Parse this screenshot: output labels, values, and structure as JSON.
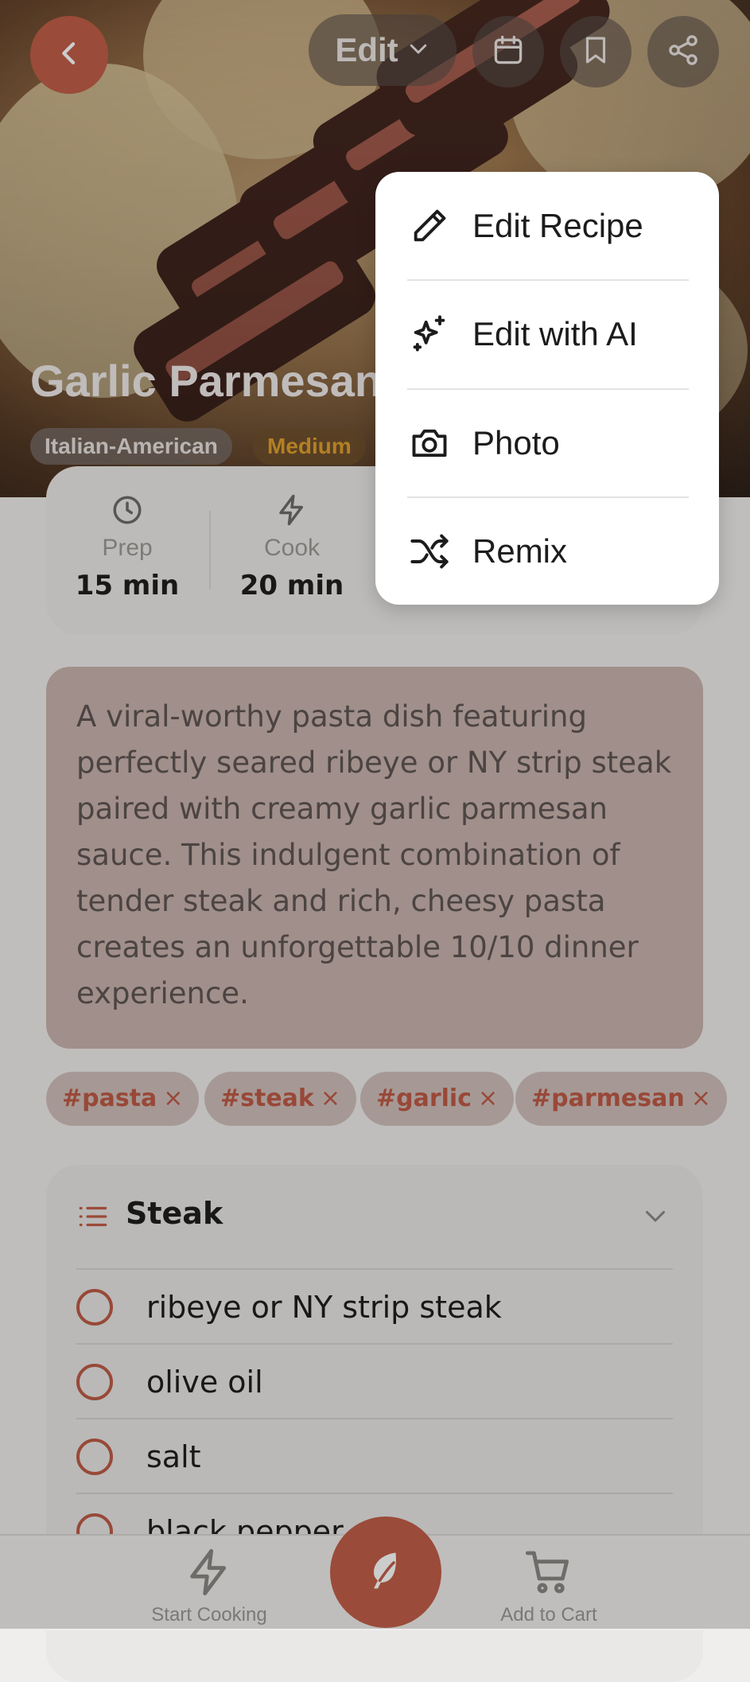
{
  "header": {
    "edit_label": "Edit",
    "icons": [
      "back-arrow-icon",
      "chevron-down-icon",
      "calendar-icon",
      "bookmark-icon",
      "share-icon"
    ]
  },
  "recipe": {
    "title": "Garlic Parmesan",
    "cuisine": "Italian-American",
    "difficulty": "Medium",
    "stats": [
      {
        "label": "Prep",
        "value": "15 min",
        "icon": "clock-icon"
      },
      {
        "label": "Cook",
        "value": "20 min",
        "icon": "bolt-icon"
      }
    ],
    "description": "A viral-worthy pasta dish featuring perfectly seared ribeye or NY strip steak paired with creamy garlic parmesan sauce. This indulgent combination of tender steak and rich, cheesy pasta creates an unforgettable 10/10 dinner experience.",
    "tags": [
      "#pasta",
      "#steak",
      "#garlic",
      "#parmesan"
    ],
    "tag_remove": "×"
  },
  "ingredients": {
    "section_title": "Steak",
    "items": [
      "ribeye or NY strip steak",
      "olive oil",
      "salt",
      "black pepper"
    ]
  },
  "menu": {
    "items": [
      {
        "label": "Edit Recipe",
        "icon": "pencil-icon"
      },
      {
        "label": "Edit with AI",
        "icon": "sparkles-icon"
      },
      {
        "label": "Photo",
        "icon": "camera-icon"
      },
      {
        "label": "Remix",
        "icon": "shuffle-icon"
      }
    ]
  },
  "bottom_bar": {
    "start_cooking": "Start Cooking",
    "add_to_cart": "Add to Cart"
  },
  "colors": {
    "accent": "#c25e48",
    "difficulty": "#e0a12c",
    "description_bg": "#c8b3ad"
  }
}
